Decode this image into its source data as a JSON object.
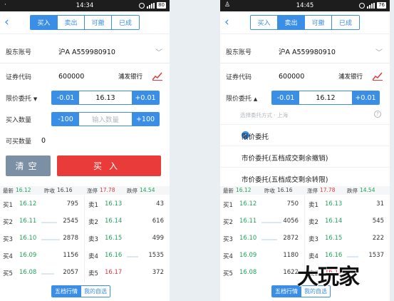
{
  "left": {
    "status": {
      "time": "14:34",
      "battery": "80"
    },
    "tabs": [
      "买入",
      "卖出",
      "可撤",
      "已成"
    ],
    "active_tab": 0,
    "account": {
      "label": "股东账号",
      "value": "沪A A559980910"
    },
    "code": {
      "label": "证券代码",
      "value": "600000",
      "stock_name": "浦发银行"
    },
    "price": {
      "label": "限价委托",
      "arrow": "▼",
      "minus": "-0.01",
      "value": "16.13",
      "plus": "+0.01"
    },
    "qty": {
      "label": "买入数量",
      "minus": "-100",
      "placeholder": "输入数量",
      "plus": "+100"
    },
    "avail": {
      "label": "可买数量",
      "value": "0"
    },
    "clear_label": "清空",
    "buy_label": "买入",
    "quote_head": {
      "last_label": "最新",
      "last": "16.12",
      "prev_label": "昨收",
      "prev": "16.16",
      "up_label": "涨停",
      "up": "17.78",
      "down_label": "跌停",
      "down": "14.54"
    },
    "bids": [
      {
        "name": "买1",
        "price": "16.12",
        "vol": "795"
      },
      {
        "name": "买2",
        "price": "16.11",
        "vol": "2545"
      },
      {
        "name": "买3",
        "price": "16.10",
        "vol": "2878"
      },
      {
        "name": "买4",
        "price": "16.09",
        "vol": "1156"
      },
      {
        "name": "买5",
        "price": "16.08",
        "vol": "2057"
      }
    ],
    "asks": [
      {
        "name": "卖1",
        "price": "16.13",
        "vol": "43"
      },
      {
        "name": "卖2",
        "price": "16.14",
        "vol": "616"
      },
      {
        "name": "卖3",
        "price": "16.15",
        "vol": "499"
      },
      {
        "name": "卖4",
        "price": "16.16",
        "vol": "1535"
      },
      {
        "name": "卖5",
        "price": "16.17",
        "vol": "372"
      }
    ],
    "bottom_tabs": [
      "五档行情",
      "我的自选"
    ]
  },
  "right": {
    "status": {
      "time": "14:45",
      "battery": "76"
    },
    "tabs": [
      "买入",
      "卖出",
      "可撤",
      "已成"
    ],
    "active_tab": 1,
    "account": {
      "label": "股东账号",
      "value": "沪A A559980910"
    },
    "code": {
      "label": "证券代码",
      "value": "600000",
      "stock_name": "浦发银行"
    },
    "price": {
      "label": "限价委托",
      "arrow": "▲",
      "minus": "-0.01",
      "value": "16.12",
      "plus": "+0.01"
    },
    "dropdown": {
      "header": "选择委托方式 · 上海",
      "help": "?",
      "options": [
        "限价委托",
        "市价委托(五档成交剩余撤销)",
        "市价委托(五档成交剩余转限)"
      ],
      "selected": 0
    },
    "quote_head": {
      "last_label": "最新",
      "last": "16.12",
      "prev_label": "昨收",
      "prev": "16.16",
      "up_label": "涨停",
      "up": "17.78",
      "down_label": "跌停",
      "down": "14.54"
    },
    "bids": [
      {
        "name": "买1",
        "price": "16.12",
        "vol": "750"
      },
      {
        "name": "买2",
        "price": "16.11",
        "vol": "4056"
      },
      {
        "name": "买3",
        "price": "16.10",
        "vol": "2872"
      },
      {
        "name": "买4",
        "price": "16.09",
        "vol": "1180"
      },
      {
        "name": "买5",
        "price": "16.08",
        "vol": "1622"
      }
    ],
    "asks": [
      {
        "name": "卖1",
        "price": "16.13",
        "vol": "31"
      },
      {
        "name": "卖2",
        "price": "16.14",
        "vol": "545"
      },
      {
        "name": "卖3",
        "price": "16.15",
        "vol": "222"
      },
      {
        "name": "卖4",
        "price": "16.16",
        "vol": "1537"
      },
      {
        "name": "卖5",
        "price": "16.17",
        "vol": ""
      }
    ],
    "bottom_tabs": [
      "五档行情",
      "我的自选"
    ]
  },
  "watermark": "大玩家"
}
